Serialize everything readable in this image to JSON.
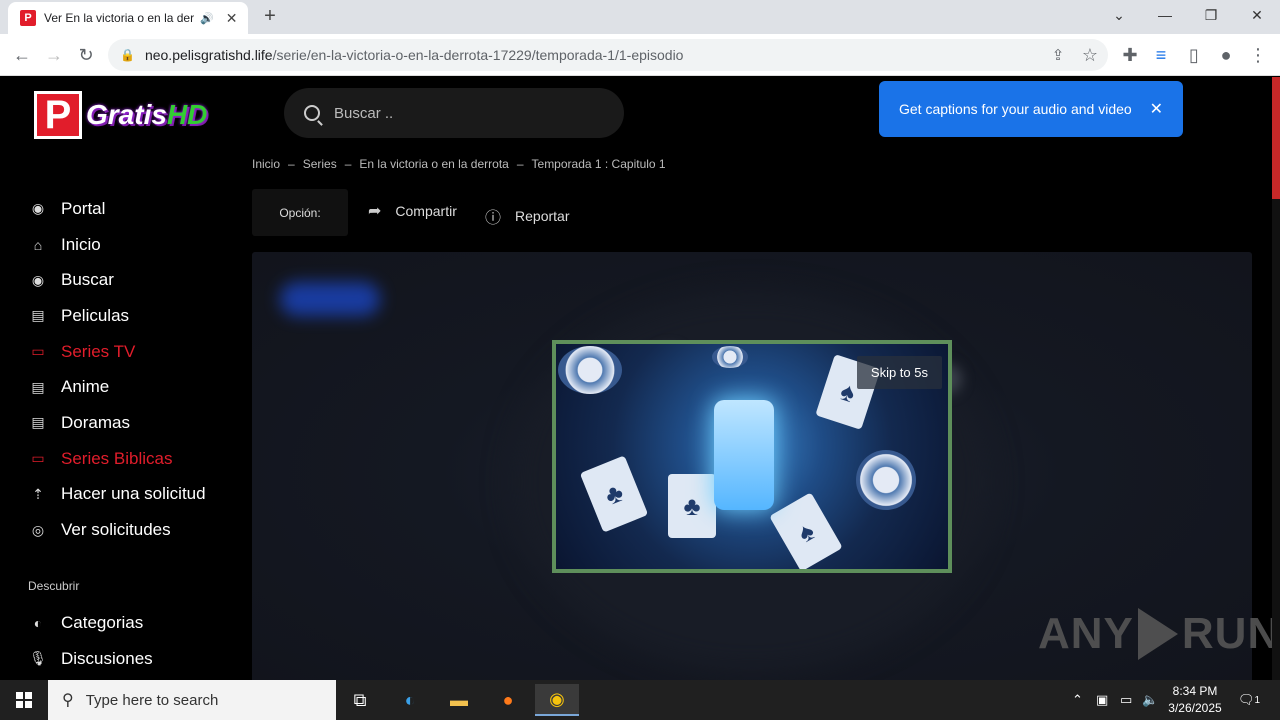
{
  "browser": {
    "tab": {
      "favicon": "P",
      "title": "Ver En la victoria o en la derrota",
      "audio_icon": "speaker-icon"
    },
    "url": {
      "host": "neo.pelisgratishd.life",
      "path": "/serie/en-la-victoria-o-en-la-derrota-17229/temporada-1/1-episodio"
    }
  },
  "site": {
    "logo": {
      "letter": "P",
      "word1": "Gratis",
      "word2": "HD"
    },
    "search_placeholder": "Buscar ..",
    "caption_popup": "Get captions for your audio and video",
    "breadcrumb": [
      "Inicio",
      "Series",
      "En la victoria o en la derrota",
      "Temporada 1 : Capitulo 1"
    ],
    "breadcrumb_sep": "–",
    "option_label": "Opción:",
    "share_label": "Compartir",
    "report_label": "Reportar",
    "nav": [
      {
        "label": "Portal",
        "icon": "broadcast-icon",
        "active": false
      },
      {
        "label": "Inicio",
        "icon": "home-icon",
        "active": false
      },
      {
        "label": "Buscar",
        "icon": "broadcast-icon",
        "active": false
      },
      {
        "label": "Peliculas",
        "icon": "film-icon",
        "active": false
      },
      {
        "label": "Series TV",
        "icon": "tv-icon",
        "active": true
      },
      {
        "label": "Anime",
        "icon": "film-icon",
        "active": false
      },
      {
        "label": "Doramas",
        "icon": "film-icon",
        "active": false
      },
      {
        "label": "Series Biblicas",
        "icon": "tv-icon",
        "active": true
      },
      {
        "label": "Hacer una solicitud",
        "icon": "upload-icon",
        "active": false
      },
      {
        "label": "Ver solicitudes",
        "icon": "eye-icon",
        "active": false
      }
    ],
    "discover_label": "Descubrir",
    "discover": [
      {
        "label": "Categorias",
        "icon": "half-circle-icon"
      },
      {
        "label": "Discusiones",
        "icon": "microphone-icon"
      }
    ],
    "ad": {
      "skip_label": "Skip to 5s"
    },
    "watermark": {
      "left": "ANY",
      "right": "RUN"
    },
    "colors": {
      "accent": "#e11d2b",
      "popup": "#1a73e8",
      "ad_border": "#5e8f5b"
    }
  },
  "taskbar": {
    "search_placeholder": "Type here to search",
    "time": "8:34 PM",
    "date": "3/26/2025",
    "notification_count": "1"
  }
}
